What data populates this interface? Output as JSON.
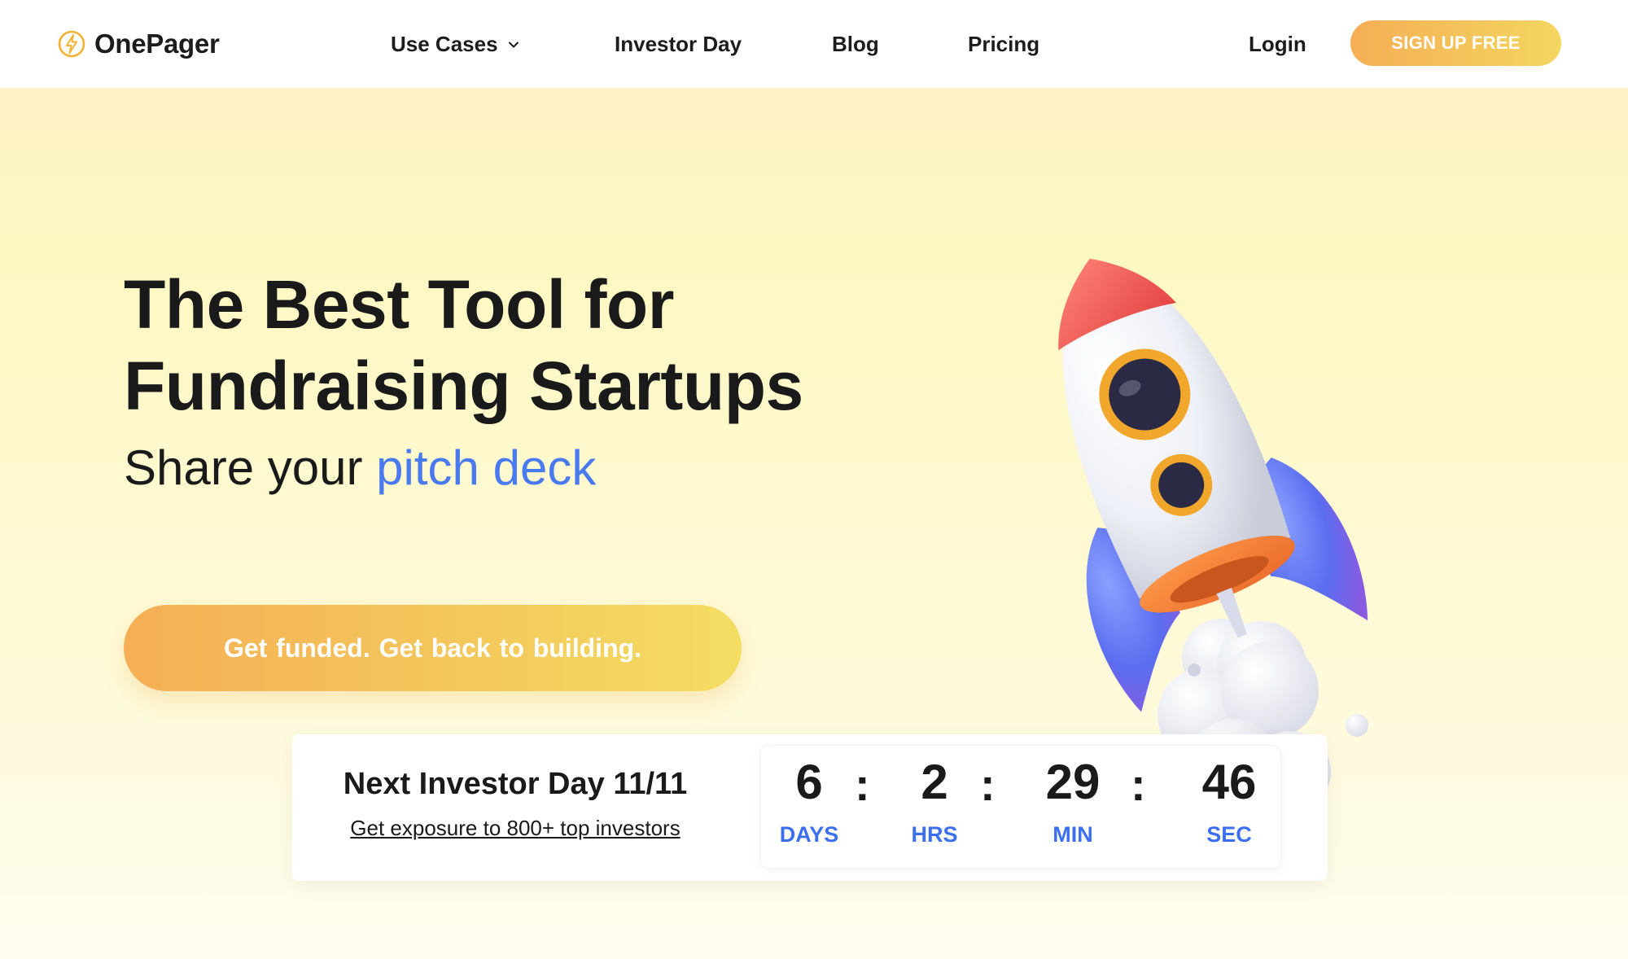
{
  "nav": {
    "logo_text": "OnePager",
    "links": [
      {
        "label": "Use Cases"
      },
      {
        "label": "Investor Day"
      },
      {
        "label": "Blog"
      },
      {
        "label": "Pricing"
      }
    ],
    "login_label": "Login",
    "signup_label": "SIGN UP FREE"
  },
  "hero": {
    "headline_line1": "The Best Tool for",
    "headline_line2": "Fundraising Startups",
    "subline_prefix": "Share your ",
    "subline_accent": "pitch deck",
    "cta_label": "Get funded.  Get back to building."
  },
  "countdown": {
    "title": "Next Investor Day 11/11",
    "link_text": "Get exposure to 800+ top investors",
    "units": [
      {
        "value": "6",
        "label": "DAYS"
      },
      {
        "value": "2",
        "label": "HRS"
      },
      {
        "value": "29",
        "label": "MIN"
      },
      {
        "value": "46",
        "label": "SEC"
      }
    ],
    "separator": ":"
  },
  "colors": {
    "accent_blue": "#4a7af0",
    "button_gradient_start": "#f5ae55",
    "button_gradient_end": "#f4d660"
  },
  "icons": [
    "lightning-bolt-icon",
    "chevron-down-icon",
    "rocket-illustration"
  ]
}
